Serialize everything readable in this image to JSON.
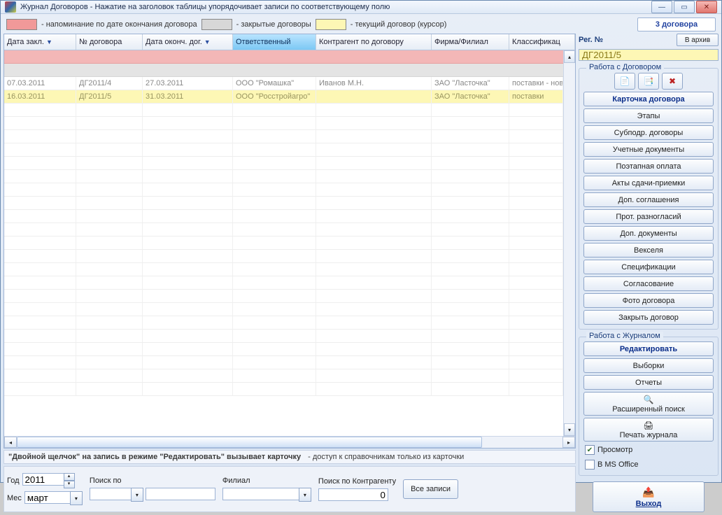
{
  "window": {
    "title": "Журнал Договоров   -   Нажатие на заголовок таблицы упорядочивает записи по соответствующему полю"
  },
  "legend": {
    "reminder": "- напоминание по дате окончания договора",
    "closed": "- закрытые договоры",
    "current": "- текущий договор (курсор)",
    "count": "3 договора"
  },
  "columns": {
    "c1": "Дата закл.",
    "c2": "№ договора",
    "c3": "Дата оконч. дог.",
    "c4": "Ответственный",
    "c5": "Контрагент по договору",
    "c6": "Фирма/Филиал",
    "c7": "Классификац"
  },
  "rows": [
    {
      "date": "07.03.2011",
      "num": "ДГ2011/4",
      "end": "27.03.2011",
      "resp": "ООО \"Ромашка\"",
      "agent": "Иванов М.Н.",
      "firm": "ЗАО \"Ласточка\"",
      "klass": "поставки - нов"
    },
    {
      "date": "16.03.2011",
      "num": "ДГ2011/5",
      "end": "31.03.2011",
      "resp": "ООО \"Росстройагро\"",
      "agent": "",
      "firm": "ЗАО \"Ласточка\"",
      "klass": "поставки"
    }
  ],
  "hint": {
    "a": "\"Двойной щелчок\" на запись в режиме \"Редактировать\" вызывает карточку",
    "b": "-  доступ к справочникам только из карточки"
  },
  "filters": {
    "year_lbl": "Год",
    "year_val": "2011",
    "month_lbl": "Мес",
    "month_val": "март",
    "search_lbl": "Поиск по",
    "branch_lbl": "Филиал",
    "agent_lbl": "Поиск по Контрагенту",
    "agent_val": "0",
    "all_btn": "Все записи"
  },
  "right": {
    "reg_lbl": "Рег. №",
    "reg_val": "ДГ2011/5",
    "archive_btn": "В архив",
    "fs1_title": "Работа с Договором",
    "fs2_title": "Работа с Журналом",
    "card": "Карточка договора",
    "stages": "Этапы",
    "subcontr": "Субподр. договоры",
    "acct": "Учетные документы",
    "staged_pay": "Поэтапная оплата",
    "acts": "Акты сдачи-приемки",
    "addagr": "Доп. соглашения",
    "prot": "Прот. разногласий",
    "adddoc": "Доп. документы",
    "bills": "Векселя",
    "spec": "Спецификации",
    "approval": "Согласование",
    "photo": "Фото договора",
    "close": "Закрыть договор",
    "edit": "Редактировать",
    "selections": "Выборки",
    "reports": "Отчеты",
    "advsearch": "Расширенный поиск",
    "print": "Печать журнала",
    "preview": "Просмотр",
    "msoffice": "В MS Office",
    "exit": "Выход"
  }
}
